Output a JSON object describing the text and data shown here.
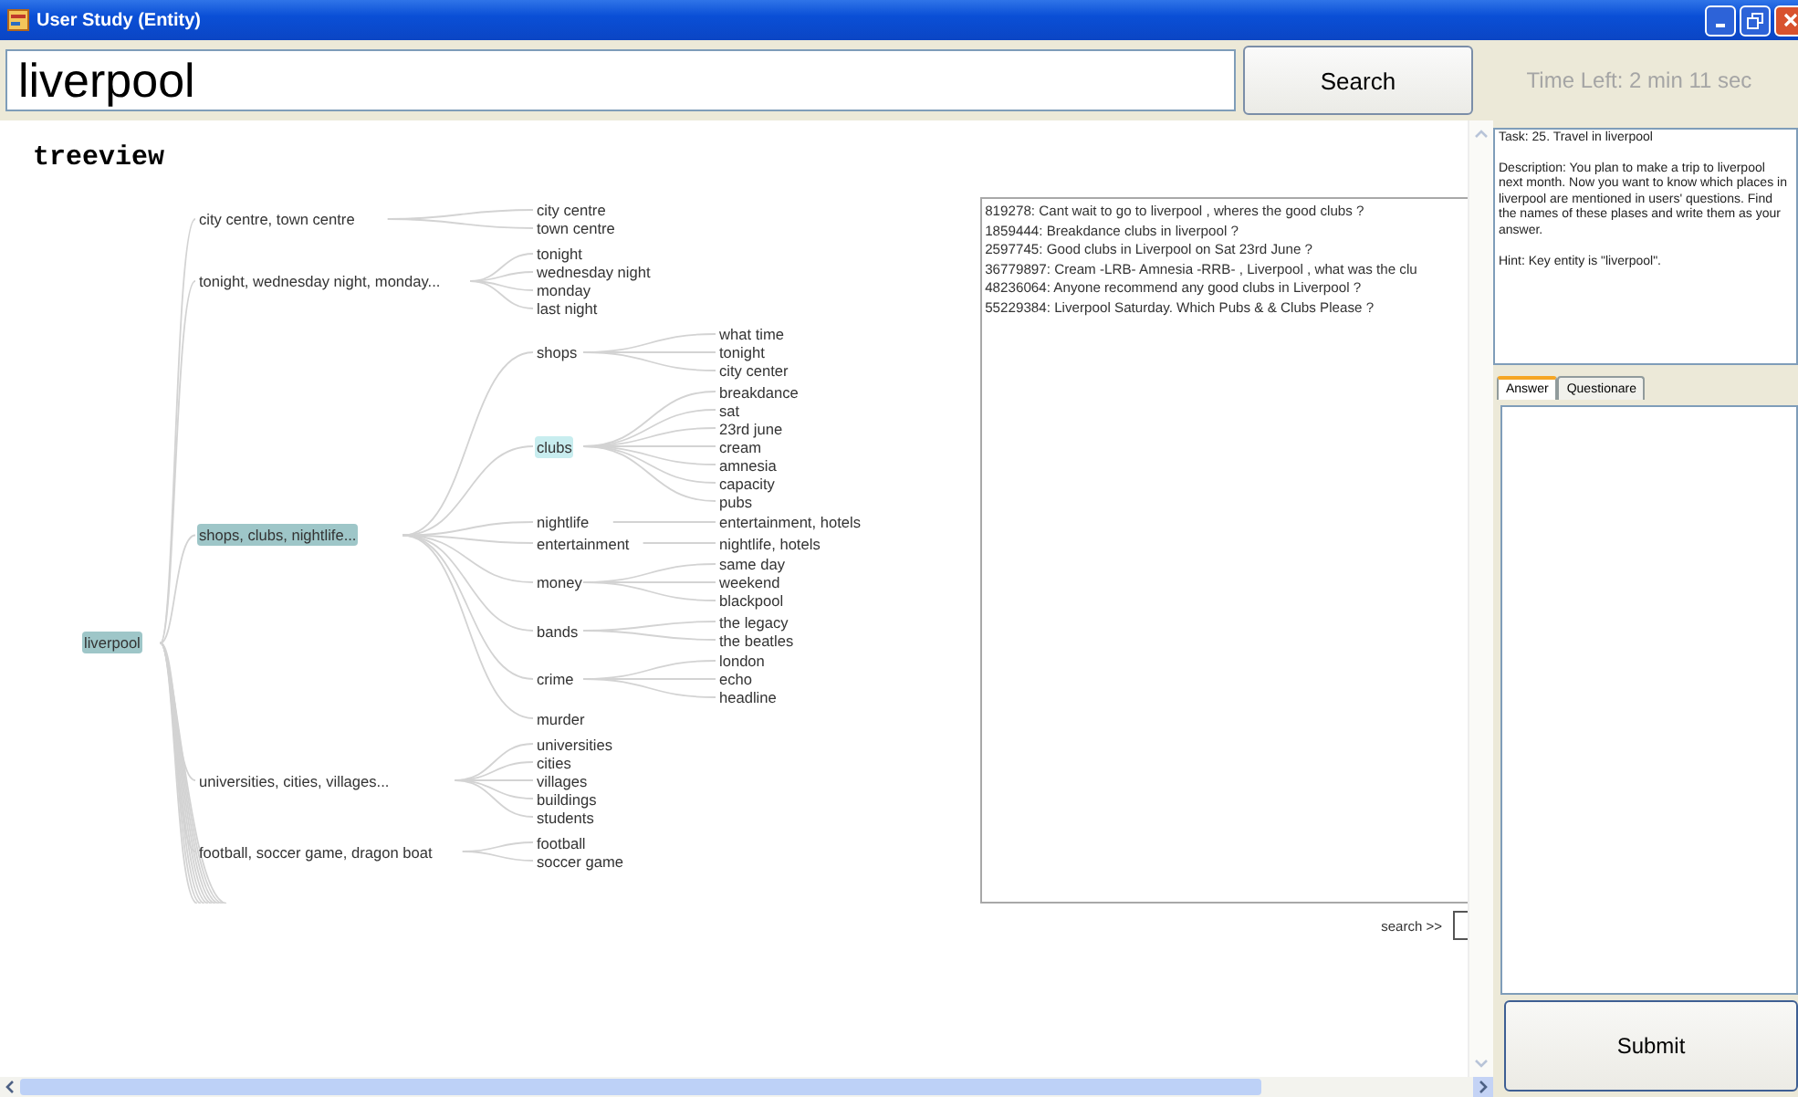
{
  "window": {
    "title": "User Study (Entity)"
  },
  "query": {
    "value": "liverpool"
  },
  "search_button": "Search",
  "time_left": "Time Left: 2 min  11 sec",
  "treeview": {
    "heading": "treeview",
    "tree": {
      "label": "liverpool",
      "highlighted": true,
      "selected": false,
      "children": [
        {
          "label": "city centre, town centre",
          "highlighted": false,
          "selected": false,
          "children": [
            {
              "label": "city centre",
              "highlighted": false,
              "selected": false
            },
            {
              "label": "town centre",
              "highlighted": false,
              "selected": false
            }
          ]
        },
        {
          "label": "tonight, wednesday night, monday...",
          "highlighted": false,
          "selected": false,
          "children": [
            {
              "label": "tonight",
              "highlighted": false,
              "selected": false
            },
            {
              "label": "wednesday night",
              "highlighted": false,
              "selected": false
            },
            {
              "label": "monday",
              "highlighted": false,
              "selected": false
            },
            {
              "label": "last night",
              "highlighted": false,
              "selected": false
            }
          ]
        },
        {
          "label": "shops, clubs, nightlife...",
          "highlighted": true,
          "selected": false,
          "children": [
            {
              "label": "shops",
              "highlighted": false,
              "selected": false,
              "children": [
                {
                  "label": "what time",
                  "highlighted": false,
                  "selected": false
                },
                {
                  "label": "tonight",
                  "highlighted": false,
                  "selected": false
                },
                {
                  "label": "city center",
                  "highlighted": false,
                  "selected": false
                }
              ]
            },
            {
              "label": "clubs",
              "highlighted": false,
              "selected": true,
              "children": [
                {
                  "label": "breakdance",
                  "highlighted": false,
                  "selected": false
                },
                {
                  "label": "sat",
                  "highlighted": false,
                  "selected": false
                },
                {
                  "label": "23rd june",
                  "highlighted": false,
                  "selected": false
                },
                {
                  "label": "cream",
                  "highlighted": false,
                  "selected": false
                },
                {
                  "label": "amnesia",
                  "highlighted": false,
                  "selected": false
                },
                {
                  "label": "capacity",
                  "highlighted": false,
                  "selected": false
                },
                {
                  "label": "pubs",
                  "highlighted": false,
                  "selected": false
                }
              ]
            },
            {
              "label": "nightlife",
              "highlighted": false,
              "selected": false,
              "children": [
                {
                  "label": "entertainment, hotels",
                  "highlighted": false,
                  "selected": false
                }
              ]
            },
            {
              "label": "entertainment",
              "highlighted": false,
              "selected": false,
              "children": [
                {
                  "label": "nightlife, hotels",
                  "highlighted": false,
                  "selected": false
                }
              ]
            },
            {
              "label": "money",
              "highlighted": false,
              "selected": false,
              "children": [
                {
                  "label": "same day",
                  "highlighted": false,
                  "selected": false
                },
                {
                  "label": "weekend",
                  "highlighted": false,
                  "selected": false
                },
                {
                  "label": "blackpool",
                  "highlighted": false,
                  "selected": false
                }
              ]
            },
            {
              "label": "bands",
              "highlighted": false,
              "selected": false,
              "children": [
                {
                  "label": "the legacy",
                  "highlighted": false,
                  "selected": false
                },
                {
                  "label": "the beatles",
                  "highlighted": false,
                  "selected": false
                }
              ]
            },
            {
              "label": "crime",
              "highlighted": false,
              "selected": false,
              "children": [
                {
                  "label": "london",
                  "highlighted": false,
                  "selected": false
                },
                {
                  "label": "echo",
                  "highlighted": false,
                  "selected": false
                },
                {
                  "label": "headline",
                  "highlighted": false,
                  "selected": false
                }
              ]
            },
            {
              "label": "murder",
              "highlighted": false,
              "selected": false
            }
          ]
        },
        {
          "label": "universities, cities, villages...",
          "highlighted": false,
          "selected": false,
          "children": [
            {
              "label": "universities",
              "highlighted": false,
              "selected": false
            },
            {
              "label": "cities",
              "highlighted": false,
              "selected": false
            },
            {
              "label": "villages",
              "highlighted": false,
              "selected": false
            },
            {
              "label": "buildings",
              "highlighted": false,
              "selected": false
            },
            {
              "label": "students",
              "highlighted": false,
              "selected": false
            }
          ]
        },
        {
          "label": "football, soccer game, dragon boat",
          "highlighted": false,
          "selected": false,
          "children": [
            {
              "label": "football",
              "highlighted": false,
              "selected": false
            },
            {
              "label": "soccer game",
              "highlighted": false,
              "selected": false
            }
          ]
        }
      ]
    }
  },
  "questions": [
    "819278: Cant wait to go to liverpool , wheres the good clubs ?",
    "1859444: Breakdance clubs in liverpool ?",
    "2597745: Good clubs in Liverpool on Sat 23rd June ?",
    "36779897: Cream -LRB- Amnesia -RRB- , Liverpool , what was the clu",
    "48236064: Anyone recommend any good clubs in Liverpool ?",
    "55229384: Liverpool Saturday. Which Pubs & & Clubs Please ?"
  ],
  "search_label": "search >>",
  "task": {
    "paragraphs": [
      "Task: 25. Travel in liverpool",
      "Description: You plan to make a trip to liverpool next month. Now you want to know which places in liverpool are mentioned in users' questions. Find the names of these plases and write them as your answer.",
      "Hint: Key entity is \"liverpool\"."
    ]
  },
  "tabs": [
    {
      "label": "Answer",
      "selected": true
    },
    {
      "label": "Questionare",
      "selected": false
    }
  ],
  "submit_button": "Submit"
}
